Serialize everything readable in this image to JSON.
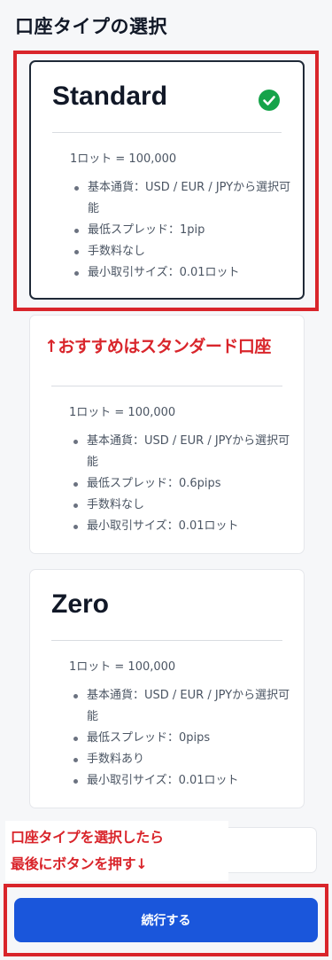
{
  "page": {
    "title": "口座タイプの選択"
  },
  "accounts": [
    {
      "name": "Standard",
      "selected": true,
      "lot": "1ロット = 100,000",
      "features": [
        "基本通貨：USD / EUR / JPYから選択可能",
        "最低スプレッド：1pip",
        "手数料なし",
        "最小取引サイズ：0.01ロット"
      ]
    },
    {
      "name": "",
      "selected": false,
      "lot": "1ロット = 100,000",
      "features": [
        "基本通貨：USD / EUR / JPYから選択可能",
        "最低スプレッド：0.6pips",
        "手数料なし",
        "最小取引サイズ：0.01ロット"
      ]
    },
    {
      "name": "Zero",
      "selected": false,
      "lot": "1ロット = 100,000",
      "features": [
        "基本通貨：USD / EUR / JPYから選択可能",
        "最低スプレッド：0pips",
        "手数料あり",
        "最小取引サイズ：0.01ロット"
      ]
    }
  ],
  "annotations": {
    "recommend": "↑おすすめはスタンダード口座",
    "select_line1": "口座タイプを選択したら",
    "select_line2": "最後にボタンを押す↓",
    "color": "#d9252b"
  },
  "continue_button": {
    "label": "続行する",
    "color": "#1a56db"
  },
  "icons": {
    "selected": "check-circle-icon",
    "selected_color": "#16a34a"
  }
}
